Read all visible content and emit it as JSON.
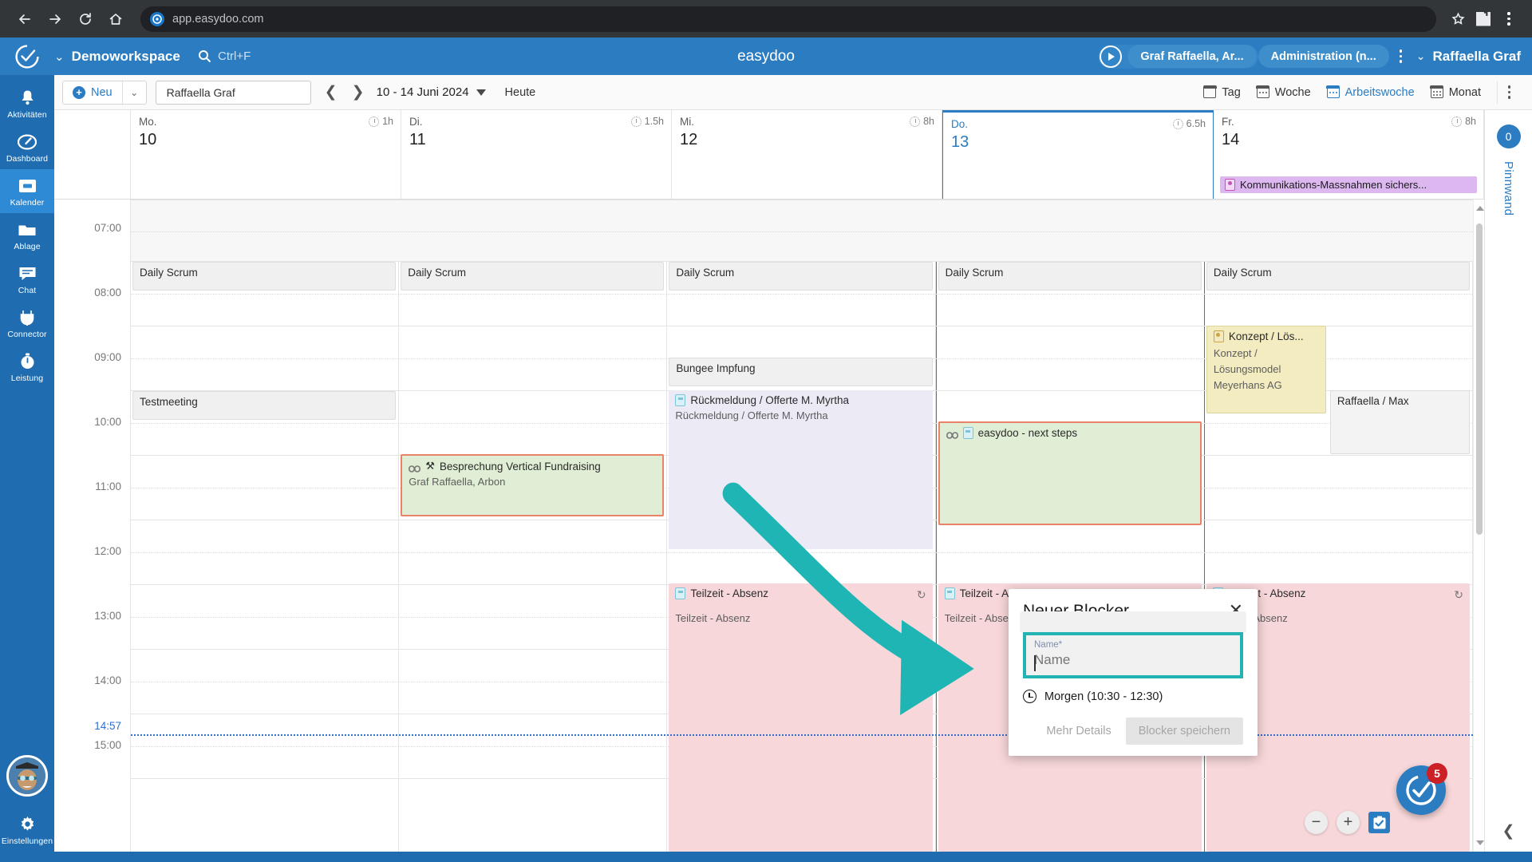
{
  "browser": {
    "url": "app.easydoo.com",
    "icons": {
      "back": "back-arrow-icon",
      "forward": "forward-arrow-icon",
      "reload": "reload-icon",
      "home": "home-icon",
      "star": "bookmark-star-icon",
      "ext": "extensions-puzzle-icon",
      "menu": "browser-menu-icon"
    }
  },
  "topbar": {
    "workspace": "Demoworkspace",
    "search_hint": "Ctrl+F",
    "brand": "easydoo",
    "play_chip": "Graf Raffaella, Ar...",
    "admin_chip": "Administration (n...",
    "user": "Raffaella Graf"
  },
  "sidebar": {
    "items": [
      {
        "label": "Aktivitäten",
        "icon": "bell-icon",
        "active": false
      },
      {
        "label": "Dashboard",
        "icon": "gauge-icon",
        "active": false
      },
      {
        "label": "Kalender",
        "icon": "calendar-icon",
        "active": true
      },
      {
        "label": "Ablage",
        "icon": "folder-icon",
        "active": false
      },
      {
        "label": "Chat",
        "icon": "chat-icon",
        "active": false
      },
      {
        "label": "Connector",
        "icon": "connector-plug-icon",
        "active": false
      },
      {
        "label": "Leistung",
        "icon": "stopwatch-icon",
        "active": false
      }
    ],
    "settings": {
      "label": "Einstellungen",
      "icon": "gear-icon"
    },
    "avatar": "user-avatar"
  },
  "toolbar": {
    "new_label": "Neu",
    "person": "Raffaella Graf",
    "date_range": "10 - 14 Juni 2024",
    "today_label": "Heute",
    "views": [
      {
        "label": "Tag",
        "active": false
      },
      {
        "label": "Woche",
        "active": false
      },
      {
        "label": "Arbeitswoche",
        "active": true
      },
      {
        "label": "Monat",
        "active": false
      }
    ]
  },
  "calendar": {
    "days": [
      {
        "name": "Mo.",
        "num": "10",
        "hours": "1h",
        "today": false,
        "allday": null
      },
      {
        "name": "Di.",
        "num": "11",
        "hours": "1.5h",
        "today": false,
        "allday": null
      },
      {
        "name": "Mi.",
        "num": "12",
        "hours": "8h",
        "today": false,
        "allday": null
      },
      {
        "name": "Do.",
        "num": "13",
        "hours": "6.5h",
        "today": true,
        "allday": null
      },
      {
        "name": "Fr.",
        "num": "14",
        "hours": "8h",
        "today": false,
        "allday": "Kommunikations-Massnahmen sichers..."
      }
    ],
    "hours": [
      "07:00",
      "08:00",
      "09:00",
      "10:00",
      "11:00",
      "12:00",
      "13:00",
      "14:00",
      "15:00"
    ],
    "now_label": "14:57",
    "events": {
      "mo": [
        {
          "title": "Daily Scrum",
          "sub": "",
          "style": "grey"
        },
        {
          "title": "Testmeeting",
          "sub": "",
          "style": "grey"
        }
      ],
      "di": [
        {
          "title": "Daily Scrum",
          "sub": "",
          "style": "grey"
        },
        {
          "title": "Besprechung Vertical Fundraising",
          "sub": "Graf Raffaella, Arbon",
          "style": "green"
        }
      ],
      "mi": [
        {
          "title": "Daily Scrum",
          "sub": "",
          "style": "grey"
        },
        {
          "title": "Bungee Impfung",
          "sub": "",
          "style": "grey"
        },
        {
          "title": "Rückmeldung / Offerte M. Myrtha",
          "sub": "Rückmeldung / Offerte M. Myrtha",
          "style": "lavender"
        },
        {
          "title": "Teilzeit - Absenz",
          "sub": "Teilzeit - Absenz",
          "style": "pink"
        }
      ],
      "do": [
        {
          "title": "Daily Scrum",
          "sub": "",
          "style": "grey"
        },
        {
          "title": "easydoo - next steps",
          "sub": "",
          "style": "greenlite"
        },
        {
          "title": "Teilzeit - Absenz",
          "sub": "Teilzeit - Absenz",
          "style": "pink"
        }
      ],
      "fr": [
        {
          "title": "Daily Scrum",
          "sub": "",
          "style": "grey"
        },
        {
          "title": "Konzept / Lös...",
          "sub": "Konzept / Lösungsmodel Meyerhans AG",
          "style": "gold"
        },
        {
          "title": "Raffaella / Max",
          "sub": "",
          "style": "white"
        },
        {
          "title": "Teilzeit - Absenz",
          "sub": "Teilzeit - Absenz",
          "style": "pink"
        }
      ]
    }
  },
  "dialog": {
    "title": "Neuer Blocker",
    "field_label": "Name*",
    "field_value": "Name",
    "time_text": "Morgen (10:30 - 12:30)",
    "more_details": "Mehr Details",
    "save": "Blocker speichern",
    "close_icon": "close-icon",
    "accent": "#24b3b3"
  },
  "rail": {
    "count": "0",
    "label": "Pinnwand"
  },
  "floating": {
    "zoom_out": "−",
    "zoom_in": "+",
    "task_badge": "5"
  }
}
